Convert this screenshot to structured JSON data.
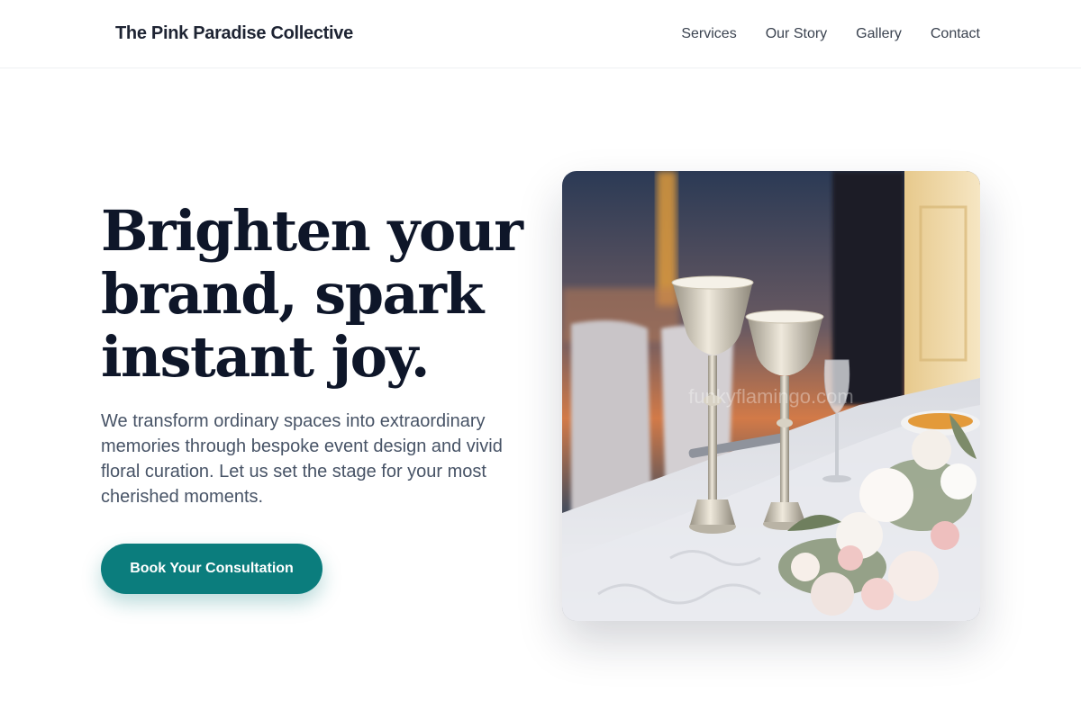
{
  "header": {
    "brand": "The Pink Paradise Collective",
    "nav": [
      "Services",
      "Our Story",
      "Gallery",
      "Contact"
    ]
  },
  "hero": {
    "headline": "Brighten your brand, spark instant joy.",
    "subtext": "We transform ordinary spaces into extraordinary memories through bespoke event design and vivid floral curation. Let us set the stage for your most cherished moments.",
    "cta_label": "Book Your Consultation",
    "image_watermark": "funkyflamingo.com"
  },
  "colors": {
    "accent": "#0b7d7d",
    "heading": "#0e1629",
    "body_text": "#475366"
  }
}
